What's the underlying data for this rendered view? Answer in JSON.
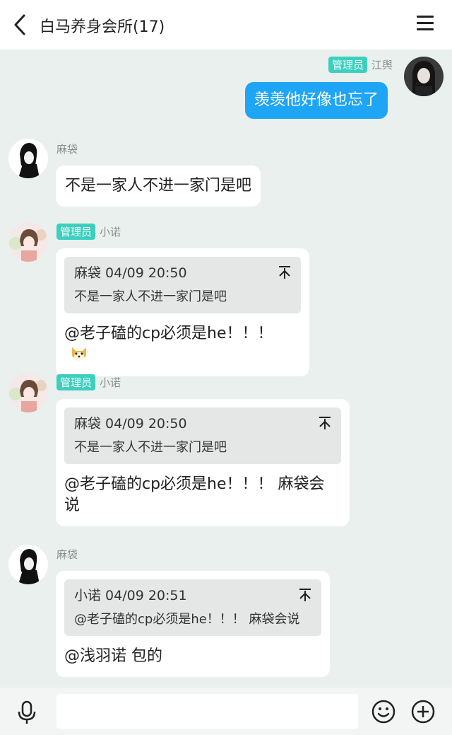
{
  "header": {
    "title": "白马养身会所(17)"
  },
  "messages": [
    {
      "sender": "江舆",
      "badge": "管理员",
      "text": "羡羡他好像也忘了"
    },
    {
      "sender": "麻袋",
      "text": "不是一家人不进一家门是吧"
    },
    {
      "sender": "小诺",
      "badge": "管理员",
      "quote": {
        "meta": "麻袋 04/09 20:50",
        "text": "不是一家人不进一家门是吧"
      },
      "text": "@老子磕的cp必须是he！！！"
    },
    {
      "sender": "小诺",
      "badge": "管理员",
      "quote": {
        "meta": "麻袋 04/09 20:50",
        "text": "不是一家人不进一家门是吧"
      },
      "text_line1": "@老子磕的cp必须是he！！！ 麻袋会",
      "text_line2": "说"
    },
    {
      "sender": "麻袋",
      "quote": {
        "meta": "小诺 04/09 20:51",
        "text": "@老子磕的cp必须是he！！！ 麻袋会说"
      },
      "text": "@浅羽诺 包的"
    }
  ],
  "icons": {
    "back": "chevron-left-icon",
    "menu": "menu-icon",
    "mic": "microphone-icon",
    "emoji": "smiley-icon",
    "plus": "plus-circle-icon",
    "pin": "pin-icon",
    "dog": "shiba-emoji"
  }
}
